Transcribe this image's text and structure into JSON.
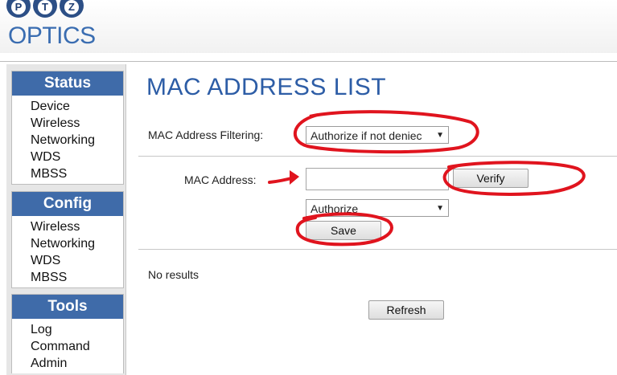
{
  "logo": {
    "letters": [
      "P",
      "T",
      "Z"
    ],
    "word": "OPTICS"
  },
  "sidebar": {
    "sections": [
      {
        "title": "Status",
        "items": [
          "Device",
          "Wireless",
          "Networking",
          "WDS",
          "MBSS"
        ]
      },
      {
        "title": "Config",
        "items": [
          "Wireless",
          "Networking",
          "WDS",
          "MBSS"
        ]
      },
      {
        "title": "Tools",
        "items": [
          "Log",
          "Command",
          "Admin"
        ]
      }
    ]
  },
  "main": {
    "title": "MAC ADDRESS LIST",
    "filtering_label": "MAC Address Filtering:",
    "filtering_value": "Authorize if not deniec",
    "mac_label": "MAC Address:",
    "mac_value": "",
    "verify_label": "Verify",
    "mode_value": "Authorize",
    "save_label": "Save",
    "results_text": "No results",
    "refresh_label": "Refresh"
  },
  "colors": {
    "accent": "#3f6ba9",
    "title": "#2d5da6",
    "annotation": "#e0141e"
  }
}
